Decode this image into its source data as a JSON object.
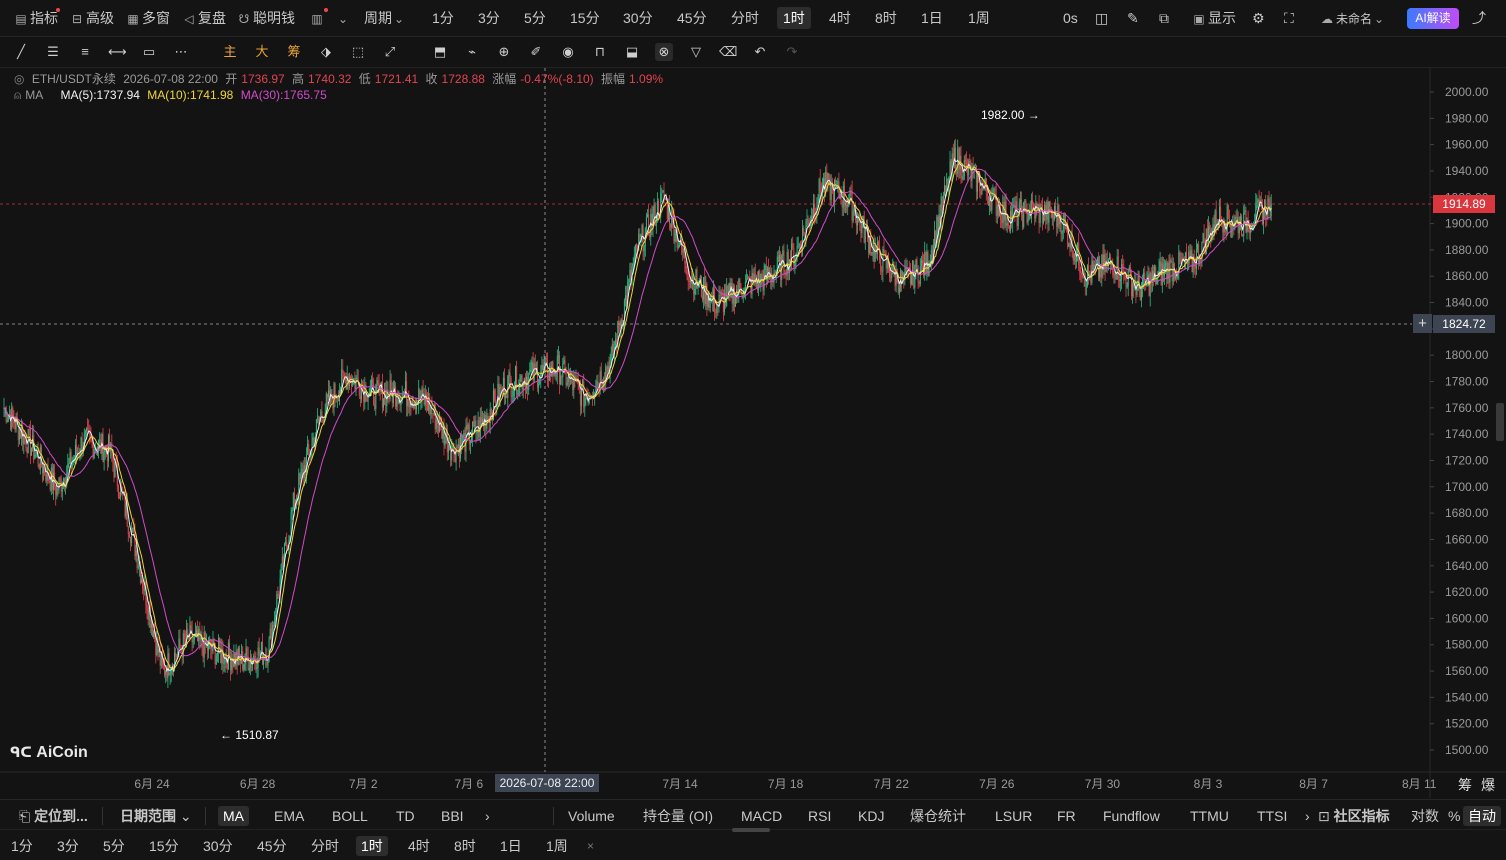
{
  "topbar": {
    "indicators": "指标",
    "advanced": "高级",
    "multi_window": "多窗",
    "replay": "复盘",
    "smart_money": "聪明钱",
    "period_label": "周期",
    "periods": [
      "1分",
      "3分",
      "5分",
      "15分",
      "30分",
      "45分",
      "分时",
      "1时",
      "4时",
      "8时",
      "1日",
      "1周"
    ],
    "active_period": "1时",
    "countdown": "0s",
    "display": "显示",
    "layout_name": "未命名",
    "ai_button": "AI解读"
  },
  "legend": {
    "symbol": "ETH/USDT永续",
    "datetime": "2026-07-08 22:00",
    "open_label": "开",
    "open": "1736.97",
    "high_label": "高",
    "high": "1740.32",
    "low_label": "低",
    "low": "1721.41",
    "close_label": "收",
    "close": "1728.88",
    "change_label": "涨幅",
    "change": "-0.47%(-8.10)",
    "amplitude_label": "振幅",
    "amplitude": "1.09%",
    "ma_name": "MA",
    "ma5": "MA(5):1737.94",
    "ma10": "MA(10):1741.98",
    "ma30": "MA(30):1765.75"
  },
  "annotations": {
    "high_marker": "1982.00",
    "low_marker": "1510.87",
    "current_price": "1914.89",
    "crosshair_price": "1824.72",
    "crosshair_date": "2026-07-08 22:00"
  },
  "logo": "AiCoin",
  "colors": {
    "up": "#2ebd85",
    "down": "#e2454f",
    "ma5": "#f2f2f2",
    "ma10": "#f0d43a",
    "ma30": "#d04cc8",
    "price_tag": "#d9363e"
  },
  "chart_data": {
    "type": "candlestick",
    "timeframe": "1时",
    "y_ticks": [
      "2000.00",
      "1980.00",
      "1960.00",
      "1940.00",
      "1920.00",
      "1900.00",
      "1880.00",
      "1860.00",
      "1840.00",
      "1820.00",
      "1800.00",
      "1780.00",
      "1760.00",
      "1740.00",
      "1720.00",
      "1700.00",
      "1680.00",
      "1660.00",
      "1640.00",
      "1620.00",
      "1600.00",
      "1580.00",
      "1560.00",
      "1540.00",
      "1520.00",
      "1500.00"
    ],
    "ylim": [
      1488,
      2012
    ],
    "x_ticks": [
      "6月 24",
      "6月 28",
      "7月 2",
      "7月 6",
      "7月 14",
      "7月 18",
      "7月 22",
      "7月 26",
      "7月 30",
      "8月 3",
      "8月 7",
      "8月 11"
    ],
    "close_path": [
      {
        "x": "6月 21",
        "y": 1760
      },
      {
        "x": "6月 22",
        "y": 1732
      },
      {
        "x": "6月 23",
        "y": 1698
      },
      {
        "x": "6月 24",
        "y": 1735
      },
      {
        "x": "6月 25",
        "y": 1728
      },
      {
        "x": "6月 26",
        "y": 1652
      },
      {
        "x": "6月 27",
        "y": 1560
      },
      {
        "x": "6月 28",
        "y": 1585
      },
      {
        "x": "6月 29",
        "y": 1575
      },
      {
        "x": "6月 30",
        "y": 1568
      },
      {
        "x": "7月 1",
        "y": 1575
      },
      {
        "x": "7月 2",
        "y": 1690
      },
      {
        "x": "7月 3",
        "y": 1755
      },
      {
        "x": "7月 4",
        "y": 1785
      },
      {
        "x": "7月 5",
        "y": 1770
      },
      {
        "x": "7月 6",
        "y": 1772
      },
      {
        "x": "7月 7",
        "y": 1765
      },
      {
        "x": "7月 8",
        "y": 1728
      },
      {
        "x": "7月 9",
        "y": 1745
      },
      {
        "x": "7月 10",
        "y": 1778
      },
      {
        "x": "7月 11",
        "y": 1785
      },
      {
        "x": "7月 12",
        "y": 1790
      },
      {
        "x": "7月 13",
        "y": 1768
      },
      {
        "x": "7月 14",
        "y": 1795
      },
      {
        "x": "7月 15",
        "y": 1882
      },
      {
        "x": "7月 16",
        "y": 1920
      },
      {
        "x": "7月 17",
        "y": 1860
      },
      {
        "x": "7月 18",
        "y": 1838
      },
      {
        "x": "7月 19",
        "y": 1852
      },
      {
        "x": "7月 20",
        "y": 1860
      },
      {
        "x": "7月 21",
        "y": 1878
      },
      {
        "x": "7月 22",
        "y": 1930
      },
      {
        "x": "7月 23",
        "y": 1918
      },
      {
        "x": "7月 24",
        "y": 1878
      },
      {
        "x": "7月 25",
        "y": 1855
      },
      {
        "x": "7月 26",
        "y": 1870
      },
      {
        "x": "7月 27",
        "y": 1950
      },
      {
        "x": "7月 28",
        "y": 1930
      },
      {
        "x": "7月 29",
        "y": 1905
      },
      {
        "x": "7月 30",
        "y": 1910
      },
      {
        "x": "7月 31",
        "y": 1905
      },
      {
        "x": "8月 1",
        "y": 1860
      },
      {
        "x": "8月 2",
        "y": 1870
      },
      {
        "x": "8月 3",
        "y": 1850
      },
      {
        "x": "8月 4",
        "y": 1865
      },
      {
        "x": "8月 5",
        "y": 1870
      },
      {
        "x": "8月 6",
        "y": 1905
      },
      {
        "x": "8月 7",
        "y": 1900
      },
      {
        "x": "8月 8",
        "y": 1914.89
      }
    ]
  },
  "bottombar": {
    "locate": "定位到...",
    "date_range": "日期范围",
    "indicators": [
      "MA",
      "EMA",
      "BOLL",
      "TD",
      "BBI"
    ],
    "sub_indicators": [
      "Volume",
      "持仓量 (OI)",
      "MACD",
      "RSI",
      "KDJ",
      "爆仓统计",
      "LSUR",
      "FR",
      "Fundflow",
      "TTMU",
      "TTSI"
    ],
    "community": "社区指标",
    "log": "对数",
    "percent": "%",
    "auto": "自动",
    "side_labels": [
      "筹",
      "爆"
    ],
    "periods": [
      "1分",
      "3分",
      "5分",
      "15分",
      "30分",
      "45分",
      "分时",
      "1时",
      "4时",
      "8时",
      "1日",
      "1周"
    ],
    "active_period": "1时",
    "close_symbol": "×"
  }
}
